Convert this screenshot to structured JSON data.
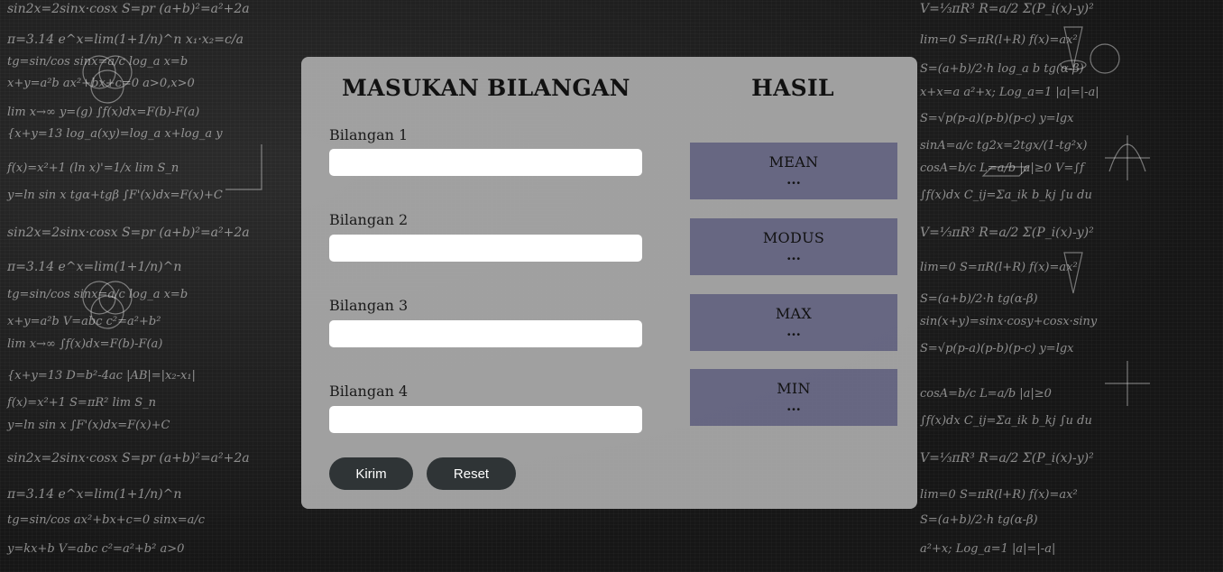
{
  "form": {
    "title": "MASUKAN BILANGAN",
    "fields": [
      {
        "label": "Bilangan 1",
        "value": ""
      },
      {
        "label": "Bilangan 2",
        "value": ""
      },
      {
        "label": "Bilangan 3",
        "value": ""
      },
      {
        "label": "Bilangan 4",
        "value": ""
      }
    ],
    "submit_label": "Kirim",
    "reset_label": "Reset"
  },
  "results": {
    "title": "HASIL",
    "items": [
      {
        "label": "MEAN",
        "value": "..."
      },
      {
        "label": "MODUS",
        "value": "..."
      },
      {
        "label": "MAX",
        "value": "..."
      },
      {
        "label": "MIN",
        "value": "..."
      }
    ]
  },
  "colors": {
    "panel": "#aaaaaa",
    "result_box": "#5f5f7d",
    "button": "#2f3436",
    "background": "#1c1c1c"
  }
}
